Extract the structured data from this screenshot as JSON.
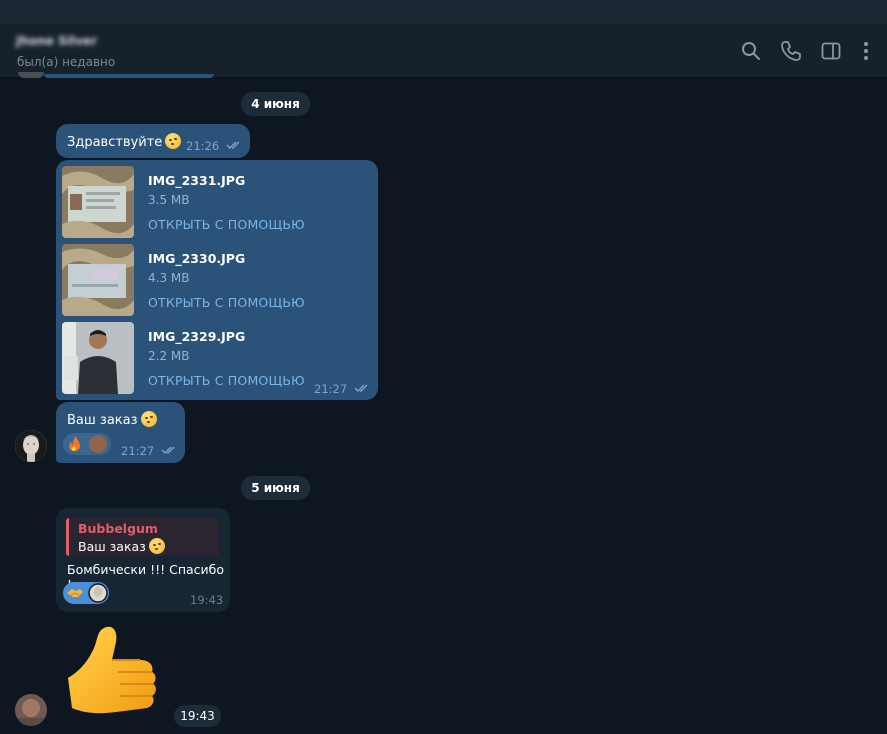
{
  "header": {
    "contact_name": "Jhone Silver",
    "status": "был(а) недавно",
    "icons": [
      "search-icon",
      "phone-icon",
      "sidebar-toggle-icon",
      "more-vertical-icon"
    ]
  },
  "dates": [
    "4 июня",
    "5 июня"
  ],
  "messages": {
    "greeting": {
      "text": "Здравствуйте",
      "time": "21:26"
    },
    "files": {
      "items": [
        {
          "name": "IMG_2331.JPG",
          "size": "3.5 MB",
          "action": "ОТКРЫТЬ С ПОМОЩЬЮ"
        },
        {
          "name": "IMG_2330.JPG",
          "size": "4.3 MB",
          "action": "ОТКРЫТЬ С ПОМОЩЬЮ"
        },
        {
          "name": "IMG_2329.JPG",
          "size": "2.2 MB",
          "action": "ОТКРЫТЬ С ПОМОЩЬЮ"
        }
      ],
      "time": "21:27"
    },
    "order": {
      "text": "Ваш заказ",
      "time": "21:27",
      "reaction": "fire-emoji"
    },
    "reply_msg": {
      "quoted_name": "Bubbelgum",
      "quoted_text": "Ваш заказ",
      "text": "Бомбически !!! Спасибо !",
      "time": "19:43",
      "reaction": "handshake-emoji"
    },
    "sticker": {
      "emoji": "thumbs-up",
      "time": "19:43"
    }
  },
  "colors": {
    "background": "#0e1621",
    "header": "#17212b",
    "outgoing_bubble": "#2b5278",
    "incoming_bubble": "#182533",
    "accent": "#7eb3e6",
    "reply_accent": "#e25d6a"
  }
}
